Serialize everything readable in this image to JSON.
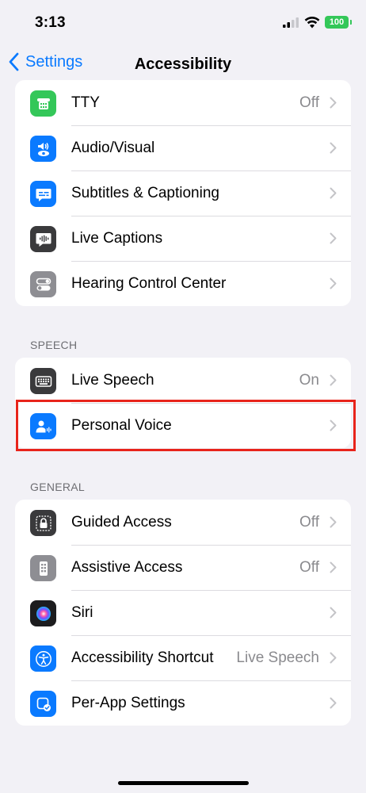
{
  "status_bar": {
    "time": "3:13",
    "battery": "100"
  },
  "nav": {
    "back_label": "Settings",
    "title": "Accessibility"
  },
  "groups": [
    {
      "header": "",
      "rows": [
        {
          "label": "TTY",
          "value": "Off",
          "icon": "tty-icon",
          "icon_color": "#34c759"
        },
        {
          "label": "Audio/Visual",
          "value": "",
          "icon": "audio-visual-icon",
          "icon_color": "#0a7aff"
        },
        {
          "label": "Subtitles & Captioning",
          "value": "",
          "icon": "subtitles-icon",
          "icon_color": "#0a7aff"
        },
        {
          "label": "Live Captions",
          "value": "",
          "icon": "live-captions-icon",
          "icon_color": "#3a3a3c"
        },
        {
          "label": "Hearing Control Center",
          "value": "",
          "icon": "hearing-control-icon",
          "icon_color": "#8e8e93"
        }
      ]
    },
    {
      "header": "SPEECH",
      "rows": [
        {
          "label": "Live Speech",
          "value": "On",
          "icon": "keyboard-icon",
          "icon_color": "#3a3a3c"
        },
        {
          "label": "Personal Voice",
          "value": "",
          "icon": "personal-voice-icon",
          "icon_color": "#0a7aff"
        }
      ]
    },
    {
      "header": "GENERAL",
      "rows": [
        {
          "label": "Guided Access",
          "value": "Off",
          "icon": "lock-icon",
          "icon_color": "#3a3a3c"
        },
        {
          "label": "Assistive Access",
          "value": "Off",
          "icon": "assistive-access-icon",
          "icon_color": "#8e8e93"
        },
        {
          "label": "Siri",
          "value": "",
          "icon": "siri-icon",
          "icon_color": "#1c1c1e"
        },
        {
          "label": "Accessibility Shortcut",
          "value": "Live Speech",
          "icon": "accessibility-icon",
          "icon_color": "#0a7aff"
        },
        {
          "label": "Per-App Settings",
          "value": "",
          "icon": "per-app-settings-icon",
          "icon_color": "#0a7aff"
        }
      ]
    }
  ],
  "colors": {
    "accent": "#0a7aff",
    "highlight": "#e8241b",
    "background": "#f2f1f6"
  }
}
